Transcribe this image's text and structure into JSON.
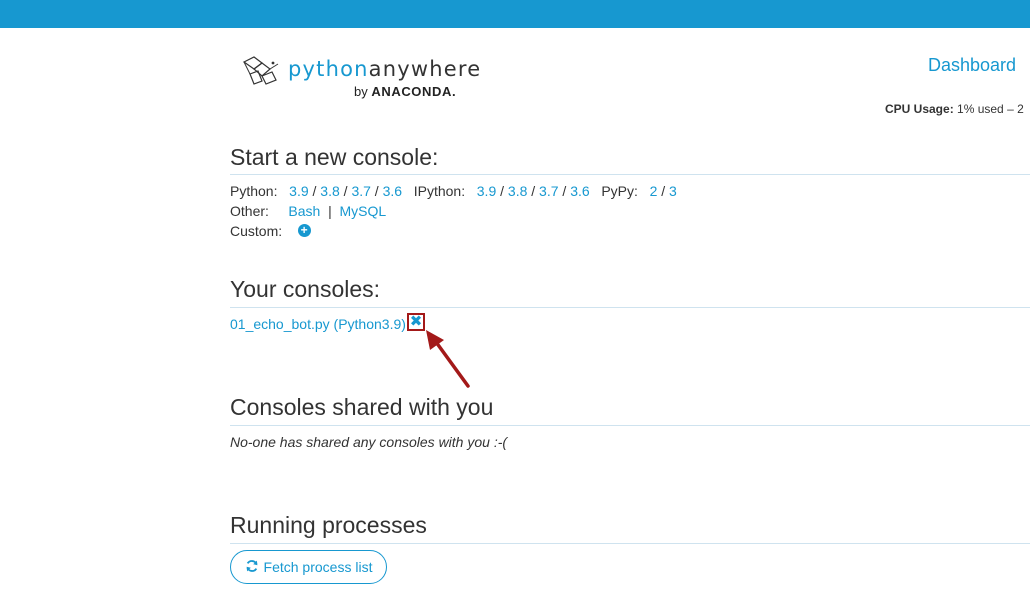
{
  "logo": {
    "word_part1": "python",
    "word_part2": "anywhere",
    "by": "by",
    "brand": "ANACONDA."
  },
  "header": {
    "dashboard": "Dashboard",
    "cpu_label": "CPU Usage:",
    "cpu_value": "1% used – 2"
  },
  "start_console": {
    "title": "Start a new console:",
    "python_label": "Python:",
    "python_versions": [
      "3.9",
      "3.8",
      "3.7",
      "3.6"
    ],
    "ipython_label": "IPython:",
    "ipython_versions": [
      "3.9",
      "3.8",
      "3.7",
      "3.6"
    ],
    "pypy_label": "PyPy:",
    "pypy_versions": [
      "2",
      "3"
    ],
    "other_label": "Other:",
    "other_items": [
      "Bash",
      "MySQL"
    ],
    "custom_label": "Custom:",
    "slash": "/",
    "pipe": "|"
  },
  "your_consoles": {
    "title": "Your consoles:",
    "console_name": "01_echo_bot.py (Python3.9)"
  },
  "shared": {
    "title": "Consoles shared with you",
    "note": "No-one has shared any consoles with you :-("
  },
  "processes": {
    "title": "Running processes",
    "fetch_label": "Fetch process list"
  },
  "colors": {
    "topbar": "#1798d0",
    "link": "#1798d0",
    "highlight": "#a31919"
  }
}
